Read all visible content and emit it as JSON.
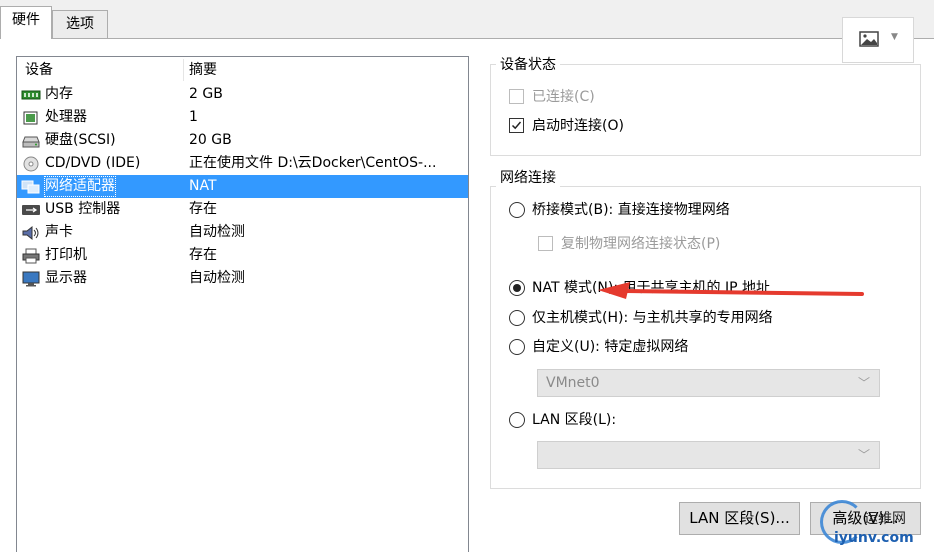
{
  "tabs": [
    {
      "label": "硬件",
      "active": true
    },
    {
      "label": "选项",
      "active": false
    }
  ],
  "image_button": {
    "icon": "image-icon",
    "dropdown_icon": "triangle-down-icon"
  },
  "device_list": {
    "header_device": "设备",
    "header_summary": "摘要",
    "rows": [
      {
        "name": "内存",
        "summary": "2 GB",
        "icon": "memory-icon",
        "selected": false
      },
      {
        "name": "处理器",
        "summary": "1",
        "icon": "processor-icon",
        "selected": false
      },
      {
        "name": "硬盘(SCSI)",
        "summary": "20 GB",
        "icon": "harddisk-icon",
        "selected": false
      },
      {
        "name": "CD/DVD (IDE)",
        "summary": "正在使用文件 D:\\云Docker\\CentOS-...",
        "icon": "cd-dvd-icon",
        "selected": false
      },
      {
        "name": "网络适配器",
        "summary": "NAT",
        "icon": "network-adapter-icon",
        "selected": true
      },
      {
        "name": "USB 控制器",
        "summary": "存在",
        "icon": "usb-icon",
        "selected": false
      },
      {
        "name": "声卡",
        "summary": "自动检测",
        "icon": "sound-icon",
        "selected": false
      },
      {
        "name": "打印机",
        "summary": "存在",
        "icon": "printer-icon",
        "selected": false
      },
      {
        "name": "显示器",
        "summary": "自动检测",
        "icon": "display-icon",
        "selected": false
      }
    ]
  },
  "device_status": {
    "title": "设备状态",
    "connected": {
      "label": "已连接(C)",
      "checked": false,
      "disabled": true
    },
    "connect_on_start": {
      "label": "启动时连接(O)",
      "checked": true,
      "disabled": false
    }
  },
  "network_connection": {
    "title": "网络连接",
    "bridged": {
      "label": "桥接模式(B): 直接连接物理网络",
      "selected": false
    },
    "replicate": {
      "label": "复制物理网络连接状态(P)",
      "checked": false,
      "disabled": true
    },
    "nat": {
      "label": "NAT 模式(N): 用于共享主机的 IP 地址",
      "selected": true
    },
    "host_only": {
      "label": "仅主机模式(H): 与主机共享的专用网络",
      "selected": false
    },
    "custom": {
      "label": "自定义(U): 特定虚拟网络",
      "selected": false
    },
    "custom_select_value": "VMnet0",
    "lan_segment": {
      "label": "LAN 区段(L):",
      "selected": false
    },
    "lan_select_value": ""
  },
  "buttons": {
    "lan_segments": "LAN 区段(S)...",
    "advanced": "高级(V)..."
  },
  "watermark": {
    "line1": "运维网",
    "line2": "iyunv.com"
  },
  "colors": {
    "selection": "#3399ff",
    "arrow": "#e53a2e"
  }
}
